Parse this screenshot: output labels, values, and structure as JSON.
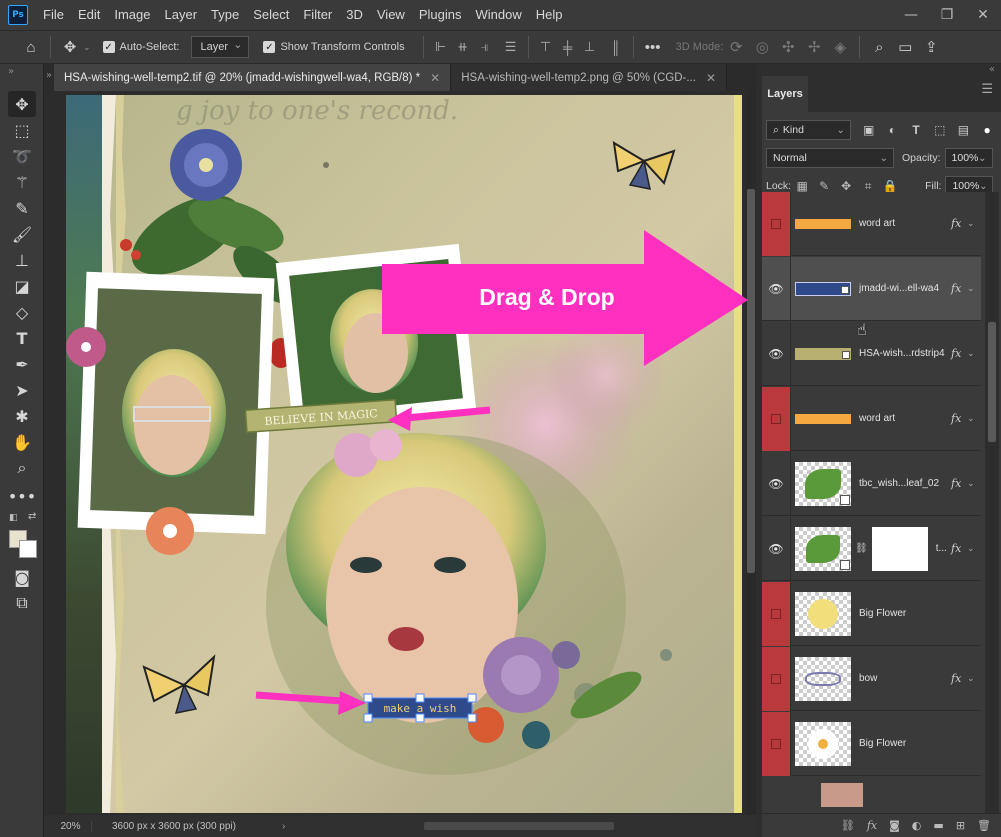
{
  "app": {
    "logo": "Ps"
  },
  "menu": [
    "File",
    "Edit",
    "Image",
    "Layer",
    "Type",
    "Select",
    "Filter",
    "3D",
    "View",
    "Plugins",
    "Window",
    "Help"
  ],
  "window_controls": {
    "minimize": "—",
    "restore": "❐",
    "close": "✕"
  },
  "options_bar": {
    "auto_select_label": "Auto-Select:",
    "auto_select_checked": true,
    "auto_select_target": "Layer",
    "show_transform_label": "Show Transform Controls",
    "show_transform_checked": true,
    "mode_3d_label": "3D Mode:"
  },
  "tabs": [
    {
      "title": "HSA-wishing-well-temp2.tif @ 20% (jmadd-wishingwell-wa4, RGB/8) *",
      "active": true
    },
    {
      "title": "HSA-wishing-well-temp2.png @ 50% (CGD-...",
      "active": false
    }
  ],
  "canvas": {
    "sticker_believe": "BELIEVE IN MAGIC",
    "word_strip": "make a wish",
    "background_script": "g joy to one's recond.",
    "accent_color": "#ff2fbf"
  },
  "annotation": {
    "big_arrow_text": "Drag & Drop"
  },
  "status": {
    "zoom": "20%",
    "doc_info": "3600 px x 3600 px (300 ppi)"
  },
  "layers_panel": {
    "title": "Layers",
    "filter_kind": "Kind",
    "blend_mode": "Normal",
    "opacity_label": "Opacity:",
    "opacity": "100%",
    "lock_label": "Lock:",
    "fill_label": "Fill:",
    "fill": "100%",
    "hidden_color": "#b9393d",
    "layers": [
      {
        "name": "word art",
        "visible": false,
        "fx": true,
        "thumb": "orange-bar"
      },
      {
        "name": "jmadd-wi...ell-wa4",
        "visible": true,
        "fx": true,
        "thumb": "word-strip",
        "selected": true
      },
      {
        "name": "HSA-wish...rdstrip4",
        "visible": true,
        "fx": true,
        "thumb": "yellow-strip"
      },
      {
        "name": "word art",
        "visible": false,
        "fx": true,
        "thumb": "orange-bar"
      },
      {
        "name": "tbc_wish...leaf_02",
        "visible": true,
        "fx": true,
        "thumb": "leaf"
      },
      {
        "name": "t...",
        "visible": true,
        "fx": true,
        "thumb": "leaf-masked"
      },
      {
        "name": "Big Flower",
        "visible": false,
        "fx": false,
        "thumb": "yellow-flower"
      },
      {
        "name": "bow",
        "visible": false,
        "fx": true,
        "thumb": "bow"
      },
      {
        "name": "Big Flower",
        "visible": false,
        "fx": false,
        "thumb": "white-flower"
      },
      {
        "name": "",
        "visible": false,
        "fx": false,
        "thumb": "photo"
      }
    ],
    "footer_icons": [
      "link-icon",
      "fx-icon",
      "mask-icon",
      "adjustment-icon",
      "group-icon",
      "new-layer-icon",
      "trash-icon"
    ]
  }
}
